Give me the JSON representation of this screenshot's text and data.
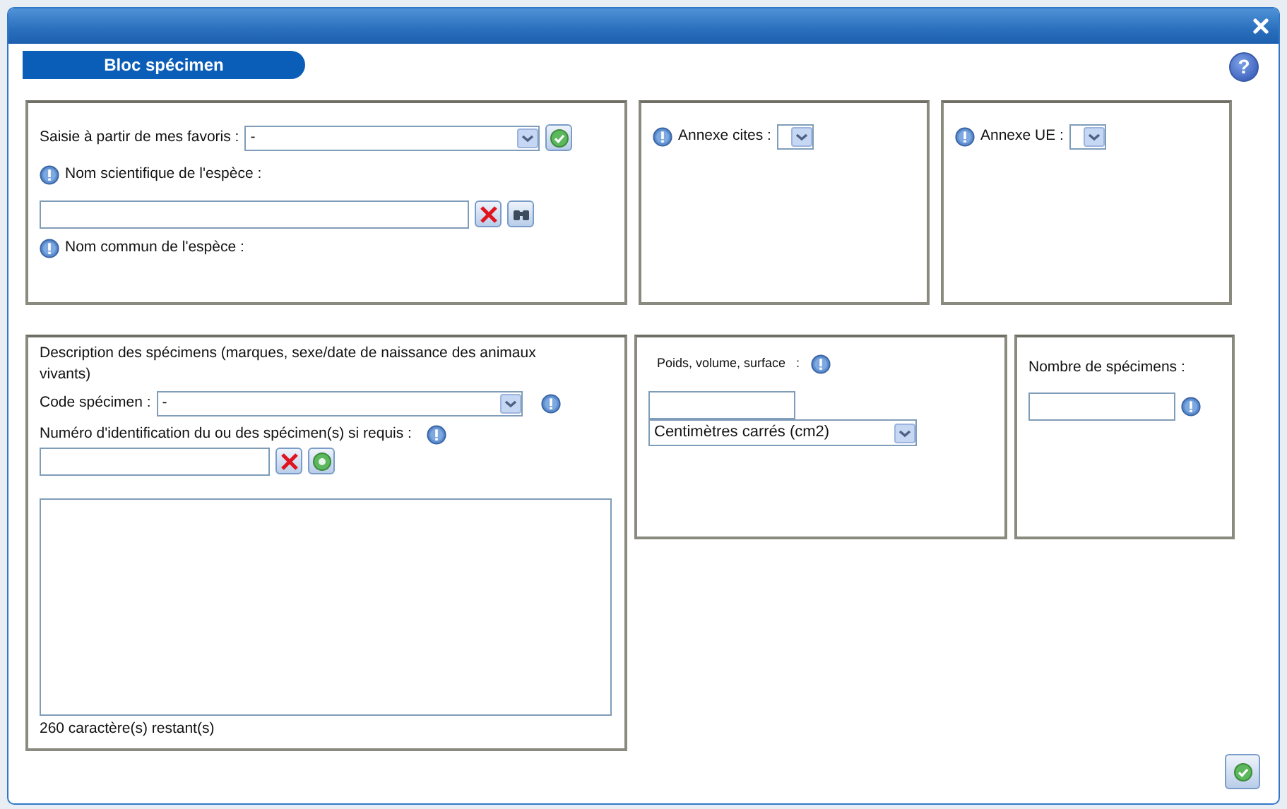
{
  "section_title": "Bloc spécimen",
  "help_label": "?",
  "favorites": {
    "label": "Saisie à partir de mes favoris :",
    "value": "-"
  },
  "scientific_name": {
    "label": "Nom scientifique de l'espèce :"
  },
  "common_name": {
    "label": "Nom commun de l'espèce :"
  },
  "annexe_cites": {
    "label": "Annexe cites :"
  },
  "annexe_ue": {
    "label": "Annexe UE :"
  },
  "description": {
    "label": "Description des spécimens (marques, sexe/date de naissance des animaux vivants)",
    "code_label": "Code spécimen :",
    "code_value": "-",
    "id_label": "Numéro d'identification du ou des spécimen(s) si requis :",
    "remaining": "260 caractère(s) restant(s)"
  },
  "measure": {
    "label": "Poids, volume, surface   :",
    "unit": "Centimètres carrés (cm2)"
  },
  "count": {
    "label": "Nombre de spécimens :"
  }
}
